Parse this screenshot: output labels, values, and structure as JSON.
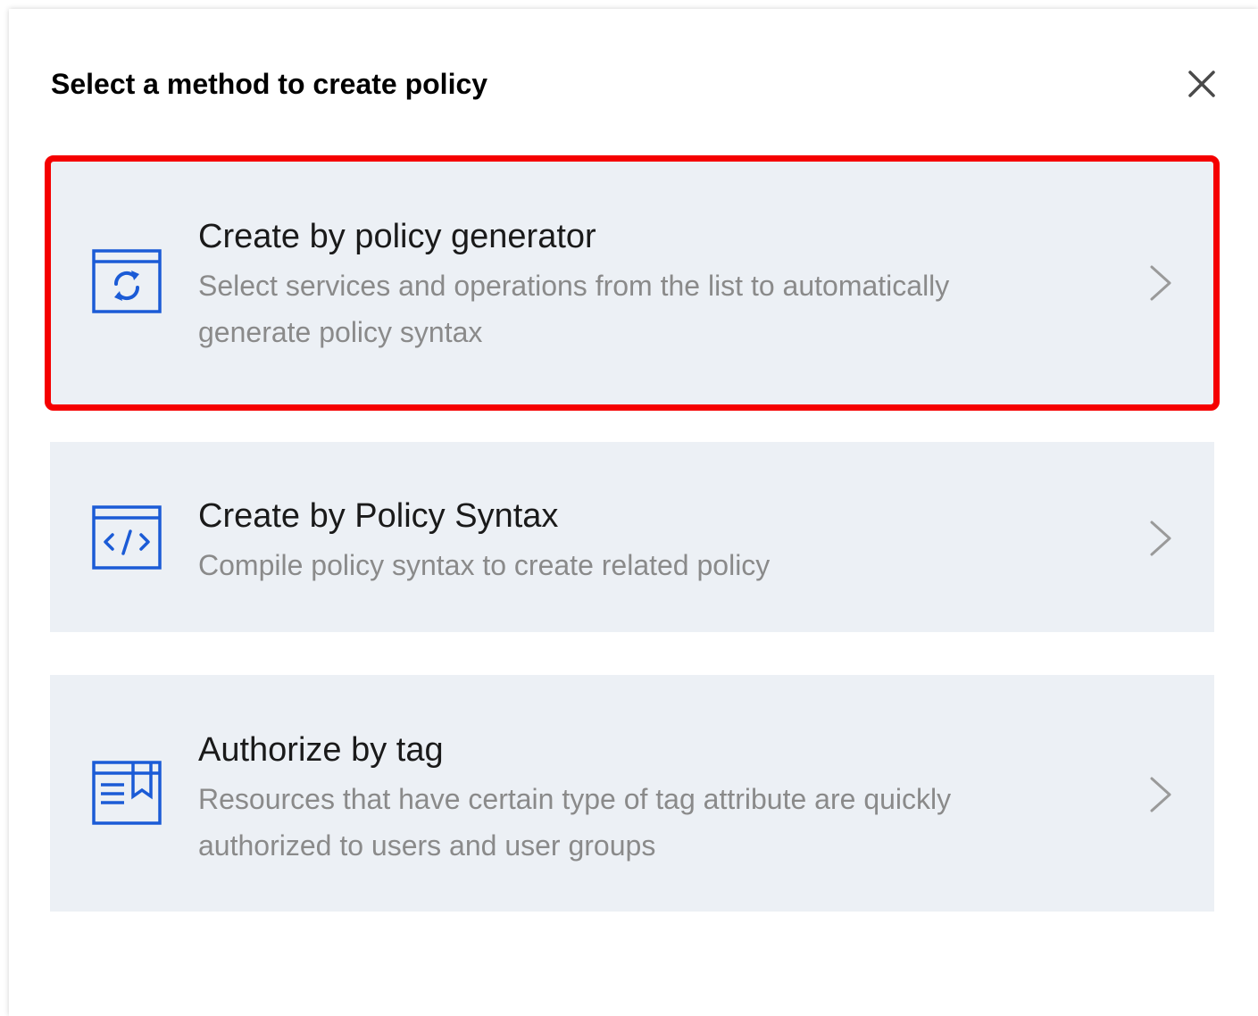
{
  "dialog": {
    "title": "Select a method to create policy",
    "close_icon": "close-icon"
  },
  "options": [
    {
      "title": "Create by policy generator",
      "description": "Select services and operations from the list to automatically generate policy syntax",
      "icon": "policy-generator-icon",
      "selected": true
    },
    {
      "title": "Create by Policy Syntax",
      "description": "Compile policy syntax to create related policy",
      "icon": "code-syntax-icon",
      "selected": false
    },
    {
      "title": "Authorize by tag",
      "description": "Resources that have certain type of tag attribute are quickly authorized to users and user groups",
      "icon": "tag-authorize-icon",
      "selected": false
    }
  ],
  "colors": {
    "accent": "#1b5bd6",
    "highlight": "#f50000",
    "card_bg": "#ecf0f5",
    "description_text": "#8a8a8a"
  }
}
